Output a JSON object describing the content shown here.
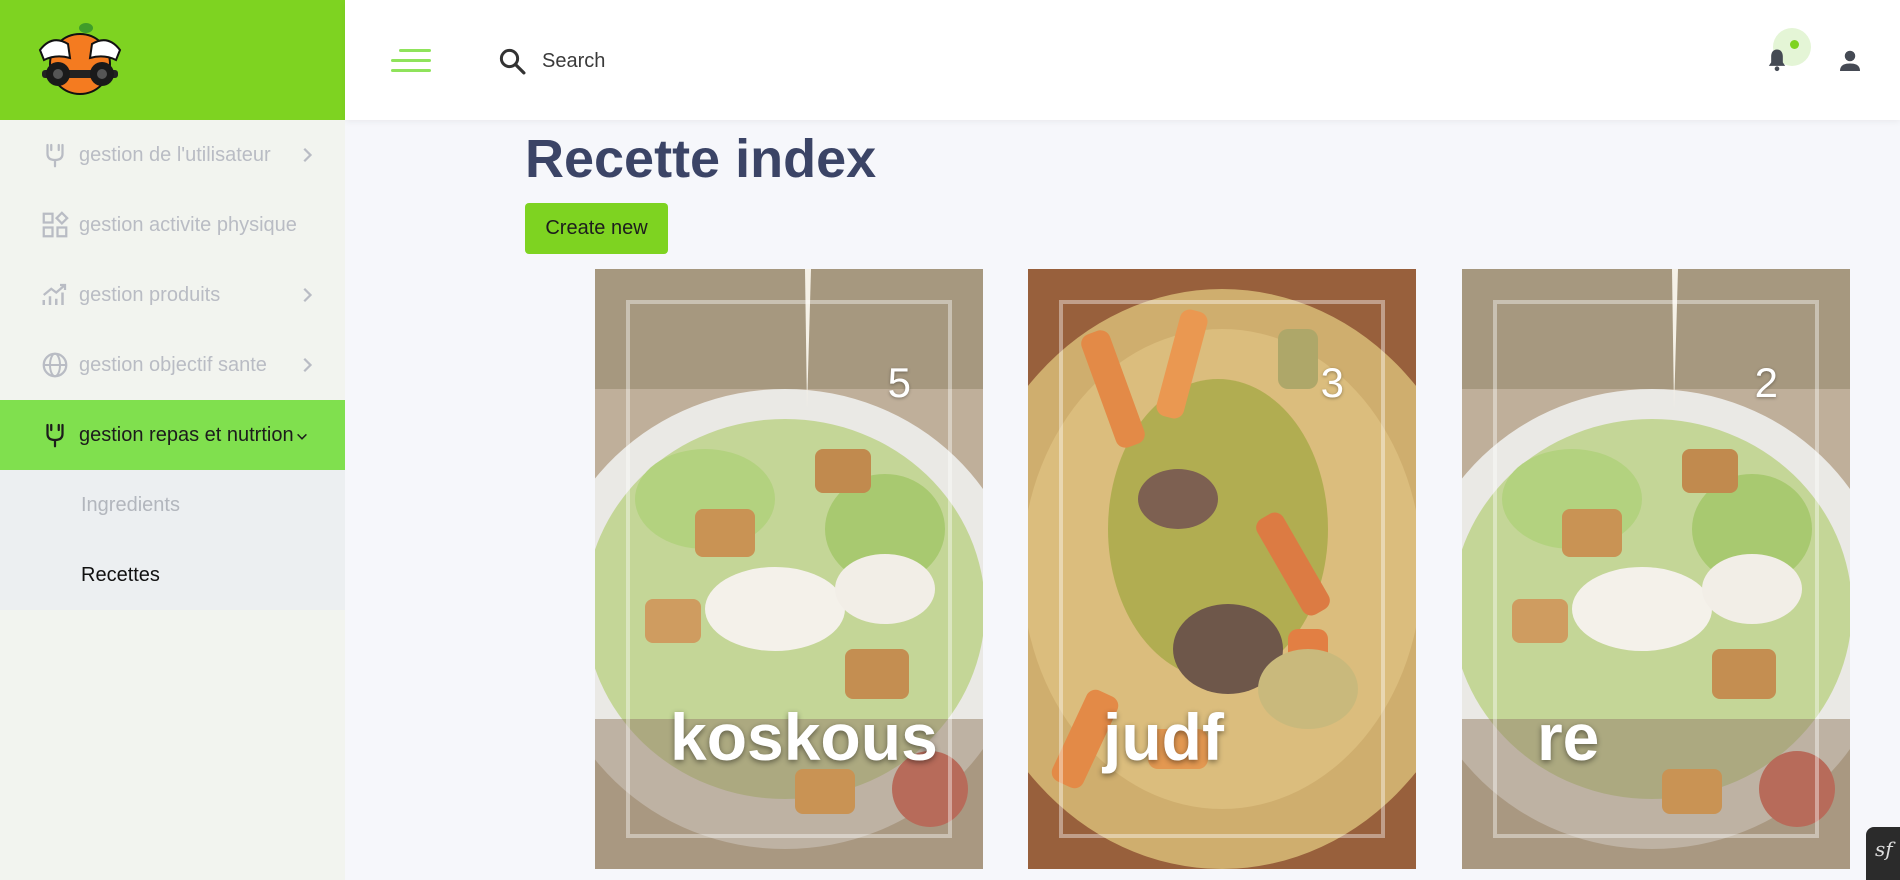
{
  "colors": {
    "brand": "#7ed321",
    "active_nav": "#80e04e",
    "title": "#3b4466"
  },
  "header": {
    "search_placeholder": "Search",
    "notification_icon": "bell-icon",
    "user_icon": "person-icon"
  },
  "sidebar": {
    "items": [
      {
        "label": "gestion de l'utilisateur",
        "icon": "plug-icon",
        "active": false
      },
      {
        "label": "gestion activite physique",
        "icon": "grid-icon",
        "active": false
      },
      {
        "label": "gestion produits",
        "icon": "chart-icon",
        "active": false
      },
      {
        "label": "gestion objectif sante",
        "icon": "globe-icon",
        "active": false
      },
      {
        "label": "gestion repas et nutrtion",
        "icon": "plug-icon",
        "active": true
      }
    ],
    "sub_items": [
      {
        "label": "Ingredients",
        "current": false
      },
      {
        "label": "Recettes",
        "current": true
      }
    ]
  },
  "main": {
    "title": "Recette index",
    "create_button": "Create new",
    "cards": [
      {
        "name": "koskous",
        "count": "5",
        "image": "salad"
      },
      {
        "name": "judf",
        "count": "3",
        "image": "couscous"
      },
      {
        "name": "re",
        "count": "2",
        "image": "salad"
      }
    ]
  },
  "corner_badge": "sf"
}
